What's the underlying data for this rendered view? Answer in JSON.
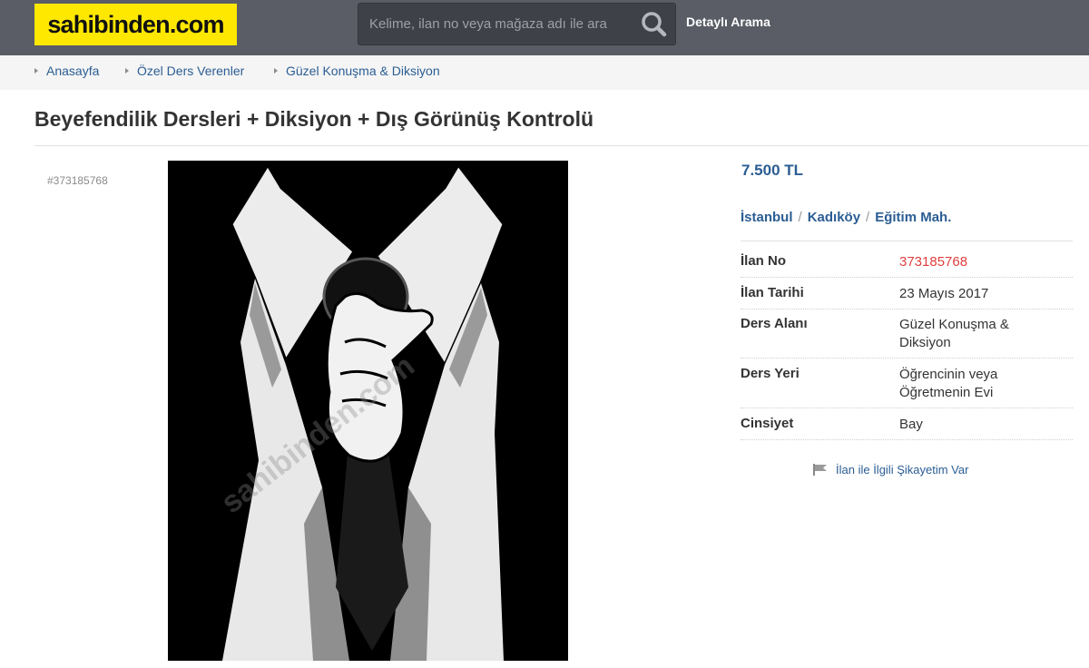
{
  "header": {
    "logo": "sahibinden.com",
    "search_placeholder": "Kelime, ilan no veya mağaza adı ile ara",
    "detailed_search": "Detaylı Arama"
  },
  "breadcrumb": [
    "Anasayfa",
    "Özel Ders Verenler",
    "Güzel Konuşma & Diksiyon"
  ],
  "listing": {
    "title": "Beyefendilik Dersleri + Diksiyon + Dış Görünüş Kontrolü",
    "id_tag": "#373185768",
    "price": "7.500 TL",
    "location": [
      "İstanbul",
      "Kadıköy",
      "Eğitim Mah."
    ],
    "location_separator": "/",
    "details": [
      {
        "label": "İlan No",
        "value": "373185768"
      },
      {
        "label": "İlan Tarihi",
        "value": "23 Mayıs 2017"
      },
      {
        "label": "Ders Alanı",
        "value": "Güzel Konuşma & Diksiyon"
      },
      {
        "label": "Ders Yeri",
        "value": "Öğrencinin veya Öğretmenin Evi"
      },
      {
        "label": "Cinsiyet",
        "value": "Bay"
      }
    ],
    "complaint_link": "İlan ile İlgili Şikayetim Var",
    "watermark": "sahibinden.com"
  },
  "colors": {
    "brand_yellow": "#ffe800",
    "header_bg": "#5a5c66",
    "link_blue": "#2b5d93",
    "id_red": "#e03e3e"
  },
  "icons": {
    "search": "search-icon",
    "breadcrumb_arrow": "breadcrumb-arrow-icon",
    "complaint": "flag-icon"
  }
}
